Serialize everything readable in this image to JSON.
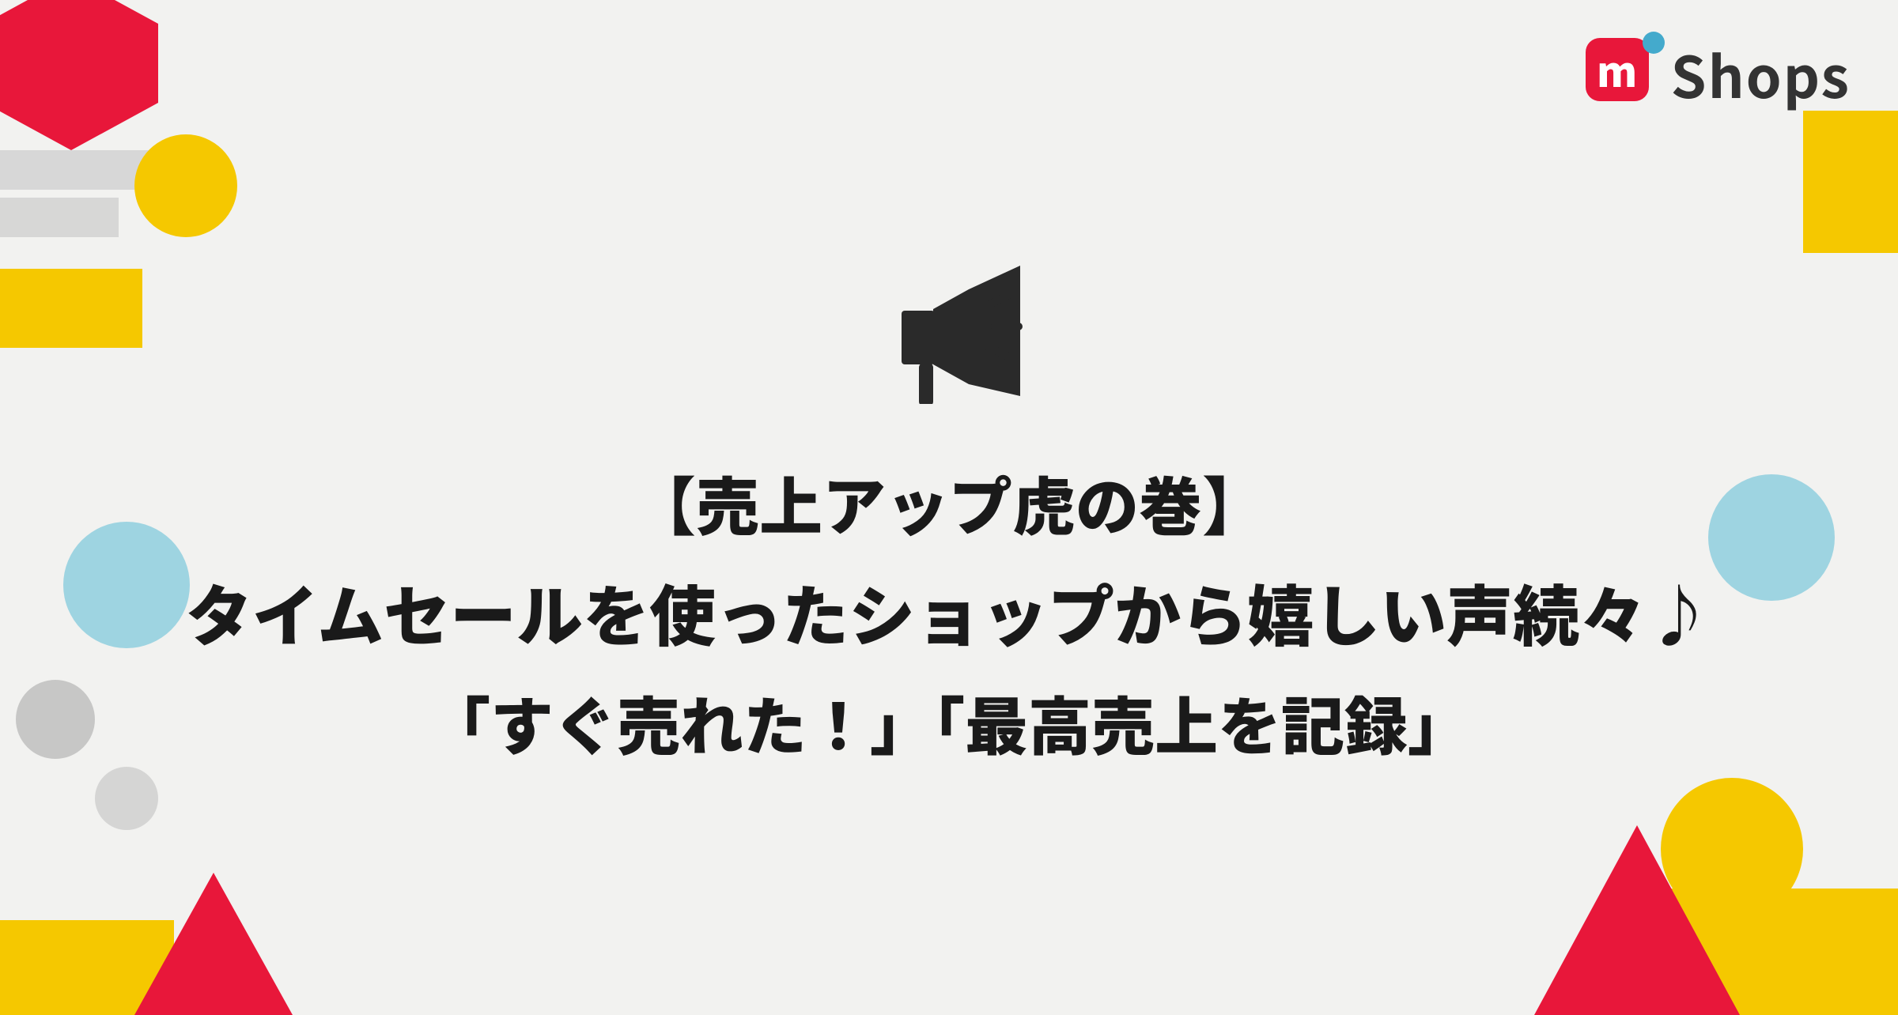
{
  "logo": {
    "m_letter": "m",
    "shops_label": "Shops"
  },
  "main": {
    "line1": "【売上アップ虎の巻】",
    "line2": "タイムセールを使ったショップから嬉しい声続々♪",
    "line3": "「すぐ売れた！」「最高売上を記録」"
  },
  "colors": {
    "background": "#f2f2f0",
    "red": "#e8173a",
    "yellow": "#f5c800",
    "blue_circle": "#44aacc",
    "blue_deco": "#88ccdd",
    "gray": "#aaaaaa",
    "text_dark": "#1a1a1a"
  }
}
